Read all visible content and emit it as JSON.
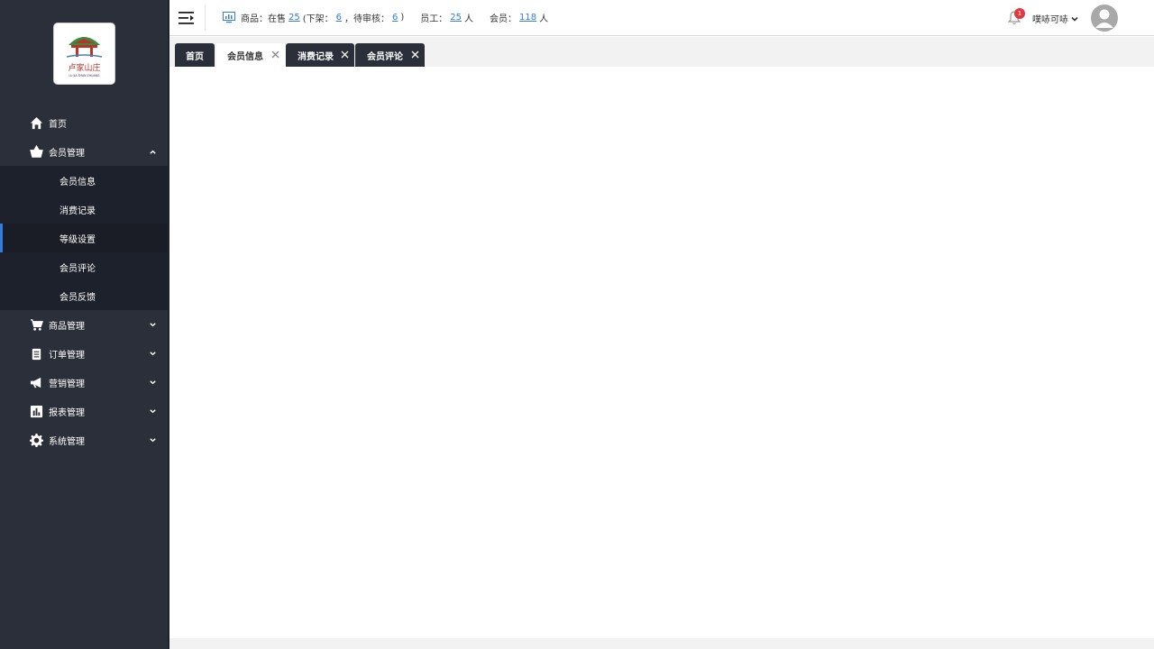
{
  "brand": {
    "logo_text": "卢家山庄",
    "logo_subtext": "LU JIA SHAN ZHUANG"
  },
  "sidebar": {
    "items": [
      {
        "label": "首页",
        "icon": "home-icon"
      },
      {
        "label": "会员管理",
        "icon": "basket-icon",
        "expanded": true,
        "children": [
          {
            "label": "会员信息"
          },
          {
            "label": "消费记录"
          },
          {
            "label": "等级设置",
            "active": true
          },
          {
            "label": "会员评论"
          },
          {
            "label": "会员反馈"
          }
        ]
      },
      {
        "label": "商品管理",
        "icon": "cart-icon"
      },
      {
        "label": "订单管理",
        "icon": "clipboard-icon"
      },
      {
        "label": "营销管理",
        "icon": "megaphone-icon"
      },
      {
        "label": "报表管理",
        "icon": "bar-chart-icon"
      },
      {
        "label": "系统管理",
        "icon": "gear-icon"
      }
    ]
  },
  "header": {
    "stats": {
      "goods_label": "商品：在售",
      "on_sale": "25",
      "off_label": "(下架：",
      "off_shelf": "6",
      "pending_label": "，待审核：",
      "pending": "6",
      "close_paren": ")",
      "staff_label": "员工：",
      "staff": "25",
      "staff_unit": "人",
      "member_label": "会员：",
      "members": "118",
      "member_unit": "人"
    },
    "notification_count": "1",
    "username": "噗哧可哧"
  },
  "tabs": [
    {
      "label": "首页",
      "closable": false,
      "style": "dark"
    },
    {
      "label": "会员信息",
      "closable": true,
      "style": "light"
    },
    {
      "label": "消费记录",
      "closable": true,
      "style": "dark"
    },
    {
      "label": "会员评论",
      "closable": true,
      "style": "dark"
    }
  ],
  "colors": {
    "sidebar_bg": "#2b2f3a",
    "submenu_bg": "#1d212b",
    "accent": "#2f7de1",
    "badge": "#e0383e"
  }
}
